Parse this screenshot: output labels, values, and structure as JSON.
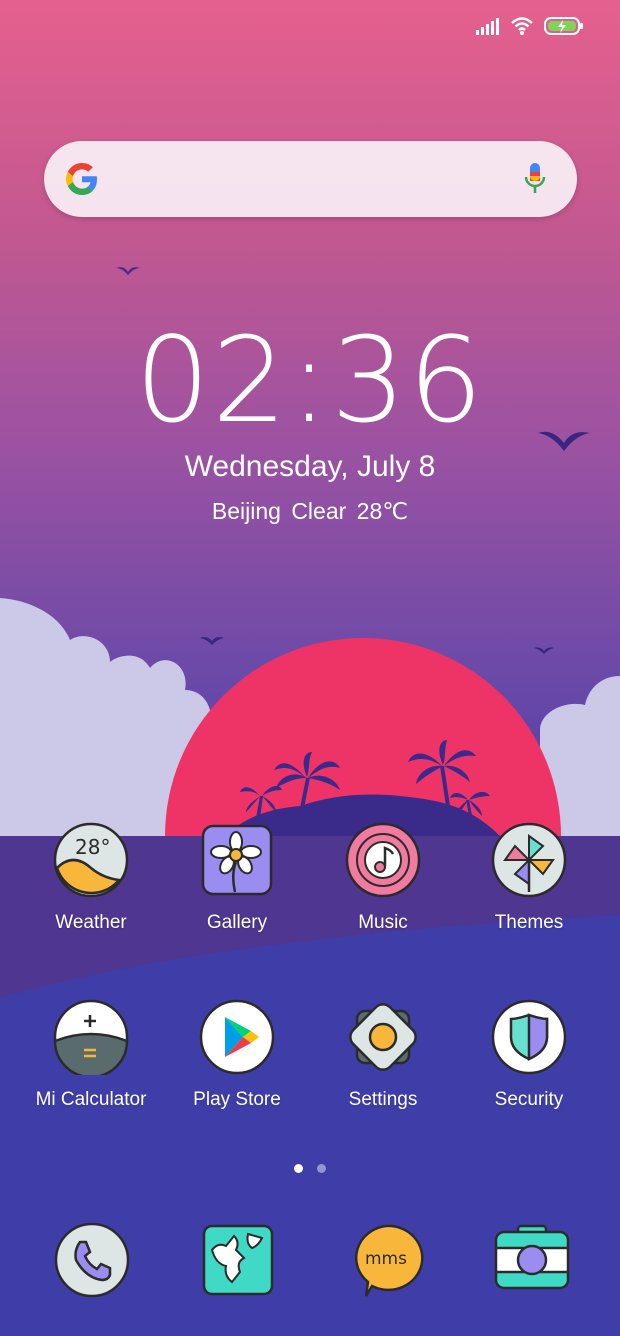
{
  "status_bar": {
    "signal_icon": "signal-bars-icon",
    "wifi_icon": "wifi-icon",
    "battery_icon": "battery-charging-icon"
  },
  "search": {
    "logo_icon": "google-g-icon",
    "mic_icon": "microphone-icon"
  },
  "clock": {
    "time": "02:36",
    "date": "Wednesday, July 8",
    "weather": "Beijing  Clear  28℃"
  },
  "apps_row1": [
    {
      "label": "Weather",
      "icon": "weather-icon",
      "temp": "28°"
    },
    {
      "label": "Gallery",
      "icon": "gallery-icon"
    },
    {
      "label": "Music",
      "icon": "music-icon"
    },
    {
      "label": "Themes",
      "icon": "themes-icon"
    }
  ],
  "apps_row2": [
    {
      "label": "Mi Calculator",
      "icon": "calculator-icon"
    },
    {
      "label": "Play Store",
      "icon": "play-store-icon"
    },
    {
      "label": "Settings",
      "icon": "settings-icon"
    },
    {
      "label": "Security",
      "icon": "security-icon"
    }
  ],
  "dock": [
    {
      "icon": "phone-icon"
    },
    {
      "icon": "maps-icon"
    },
    {
      "icon": "messaging-icon",
      "text": "mms"
    },
    {
      "icon": "camera-icon"
    }
  ],
  "page_indicator": {
    "pages": 2,
    "current": 1
  },
  "colors": {
    "sun": "#ee3466",
    "island": "#3a2b8a",
    "sea_upper": "#4e3691",
    "sea_lower": "#3f3ea8",
    "cloud": "#c9c6e6"
  }
}
